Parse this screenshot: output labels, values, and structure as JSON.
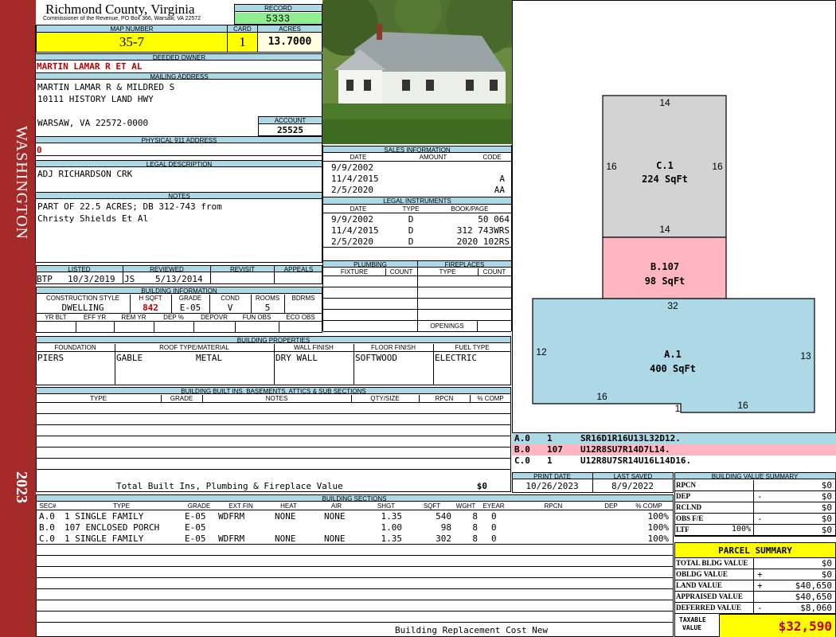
{
  "side": {
    "district": "WASHINGTON",
    "year": "2023"
  },
  "header": {
    "county": "Richmond County, Virginia",
    "commissioner": "Commissioner of the Revenue, PO Box 366, Warsaw, VA 22572",
    "record_label": "RECORD",
    "record": "5333",
    "map_label": "MAP NUMBER",
    "map": "35-7",
    "card_label": "CARD",
    "card": "1",
    "acres_label": "ACRES",
    "acres": "13.7000"
  },
  "owner": {
    "deeded_label": "DEEDED OWNER",
    "deeded": "MARTIN LAMAR R ET AL",
    "mailing_label": "MAILING ADDRESS",
    "mail1": "MARTIN LAMAR R & MILDRED S",
    "mail2": "10111 HISTORY LAND HWY",
    "mail3": "WARSAW, VA 22572-0000",
    "account_label": "ACCOUNT",
    "account": "25525",
    "physical_label": "PHYSICAL 911 ADDRESS",
    "physical": "0",
    "legal_label": "LEGAL DESCRIPTION",
    "legal": "ADJ RICHARDSON CRK",
    "notes_label": "NOTES",
    "notes1": "PART OF 22.5 ACRES; DB 312-743 from",
    "notes2": "Christy Shields Et Al"
  },
  "review": {
    "listed_label": "LISTED",
    "reviewed_label": "REVIEWED",
    "revisit_label": "REVISIT",
    "appeals_label": "APPEALS",
    "listed_by": "BTP",
    "listed_date": "10/3/2019",
    "reviewed_by": "JS",
    "reviewed_date": "5/13/2014"
  },
  "building_info": {
    "title": "BUILDING INFORMATION",
    "h1": "CONSTRUCTION STYLE",
    "h2": "H SQFT",
    "h3": "GRADE",
    "h4": "COND",
    "h5": "ROOMS",
    "h6": "BDRMS",
    "style": "DWELLING",
    "hsqft": "842",
    "grade": "E-05",
    "cond": "V",
    "rooms": "5",
    "bdrms": "",
    "g1": "YR BLT",
    "g2": "EFF YR",
    "g3": "REM YR",
    "g4": "DEP %",
    "g5": "DEPOVR",
    "g6": "FUN OBS",
    "g7": "ECO OBS"
  },
  "sales": {
    "title": "SALES INFORMATION",
    "date_h": "DATE",
    "amount_h": "AMOUNT",
    "code_h": "CODE",
    "rows": [
      {
        "date": "9/9/2002",
        "amount": "",
        "code": ""
      },
      {
        "date": "11/4/2015",
        "amount": "",
        "code": "A"
      },
      {
        "date": "2/5/2020",
        "amount": "",
        "code": "AA"
      }
    ]
  },
  "legal_instruments": {
    "title": "LEGAL INSTRUMENTS",
    "date_h": "DATE",
    "type_h": "TYPE",
    "book_h": "BOOK/PAGE",
    "rows": [
      {
        "date": "9/9/2002",
        "type": "D",
        "book": "50 064"
      },
      {
        "date": "11/4/2015",
        "type": "D",
        "book": "312 743WRS"
      },
      {
        "date": "2/5/2020",
        "type": "D",
        "book": "2020 102RS"
      }
    ]
  },
  "plumbing": {
    "title": "PLUMBING",
    "fixture_h": "FIXTURE",
    "count_h": "COUNT"
  },
  "fireplaces": {
    "title": "FIREPLACES",
    "type_h": "TYPE",
    "count_h": "COUNT",
    "openings": "OPENINGS"
  },
  "properties": {
    "title": "BUILDING PROPERTIES",
    "foundation_h": "FOUNDATION",
    "roof_h": "ROOF TYPE/MATERIAL",
    "wall_h": "WALL FINISH",
    "floor_h": "FLOOR FINISH",
    "fuel_h": "FUEL TYPE",
    "foundation": "PIERS",
    "roof_type": "GABLE",
    "roof_material": "METAL",
    "wall": "DRY WALL",
    "floor": "SOFTWOOD",
    "fuel": "ELECTRIC"
  },
  "builtins": {
    "title": "BUILDING BUILT INS, BASEMENTS, ATTICS & SUB SECTIONS",
    "type_h": "TYPE",
    "grade_h": "GRADE",
    "notes_h": "NOTES",
    "qty_h": "QTY/SIZE",
    "rpcn_h": "RPCN",
    "comp_h": "% COMP",
    "total_label": "Total Built Ins, Plumbing & Fireplace Value",
    "total": "$0"
  },
  "sections": {
    "title": "BUILDING SECTIONS",
    "headers": [
      "SEC#",
      "TYPE",
      "GRADE",
      "EXT FIN",
      "HEAT",
      "AIR",
      "SHGT",
      "SQFT",
      "WGHT",
      "EYEAR",
      "RPCN",
      "DEP",
      "% COMP"
    ],
    "rows": [
      {
        "sec": "A.0",
        "type": "1 SINGLE FAMILY",
        "grade": "E-05",
        "ext": "WDFRM",
        "heat": "NONE",
        "air": "NONE",
        "shgt": "1.35",
        "sqft": "540",
        "wght": "8",
        "eyear": "0",
        "comp": "100%"
      },
      {
        "sec": "B.0",
        "type": "107 ENCLOSED PORCH",
        "grade": "E-05",
        "ext": "",
        "heat": "",
        "air": "",
        "shgt": "1.00",
        "sqft": "98",
        "wght": "8",
        "eyear": "0",
        "comp": "100%"
      },
      {
        "sec": "C.0",
        "type": "1 SINGLE FAMILY",
        "grade": "E-05",
        "ext": "WDFRM",
        "heat": "NONE",
        "air": "NONE",
        "shgt": "1.35",
        "sqft": "302",
        "wght": "8",
        "eyear": "0",
        "comp": "100%"
      }
    ],
    "footer": "Building Replacement Cost New"
  },
  "sketch": {
    "c_label": "C.1",
    "c_area": "224 SqFt",
    "b_label": "B.107",
    "b_area": "98 SqFt",
    "a_label": "A.1",
    "a_area": "400 SqFt",
    "dims": {
      "c_top": "14",
      "c_left": "16",
      "c_right": "16",
      "c_bottom": "14",
      "a_top": "32",
      "a_left": "12",
      "a_right": "13",
      "a_b1": "16",
      "a_b2": "1",
      "a_b3": "16"
    },
    "colors": {
      "c": "#d3d3d3",
      "b": "#ffb6c1",
      "a": "#add8e6"
    }
  },
  "vectors": [
    {
      "sec": "A.0",
      "code": "1",
      "vec": "SR16D1R16U13L32D12."
    },
    {
      "sec": "B.0",
      "code": "107",
      "vec": "U12R8SU7R14D7L14."
    },
    {
      "sec": "C.0",
      "code": "1",
      "vec": "U12R8U7SR14U16L14D16."
    }
  ],
  "print": {
    "print_label": "PRINT DATE",
    "saved_label": "LAST SAVED",
    "print_date": "10/26/2023",
    "saved_date": "8/9/2022"
  },
  "bvs": {
    "title": "BUILDING VALUE SUMMARY",
    "rpcn_l": "RPCN",
    "rpcn": "$0",
    "dep_l": "DEP",
    "dep_sign": "-",
    "dep": "$0",
    "rclnd_l": "RCLND",
    "rclnd": "$0",
    "obs_l": "OBS F/E",
    "obs_sign": "-",
    "obs": "$0",
    "ltf_l": "LTF",
    "ltf_pct": "100%",
    "ltf": "$0"
  },
  "parcel": {
    "title": "PARCEL SUMMARY",
    "tbv_l": "TOTAL BLDG VALUE",
    "tbv": "$0",
    "obldg_l": "OBLDG VALUE",
    "obldg_sign": "+",
    "obldg": "$0",
    "land_l": "LAND VALUE",
    "land_sign": "+",
    "land": "$40,650",
    "appr_l": "APPRAISED VALUE",
    "appr": "$40,650",
    "def_l": "DEFERRED VALUE",
    "def_sign": "-",
    "def": "$8,060",
    "tax_l1": "TAXABLE",
    "tax_l2": "VALUE",
    "tax": "$32,590"
  }
}
